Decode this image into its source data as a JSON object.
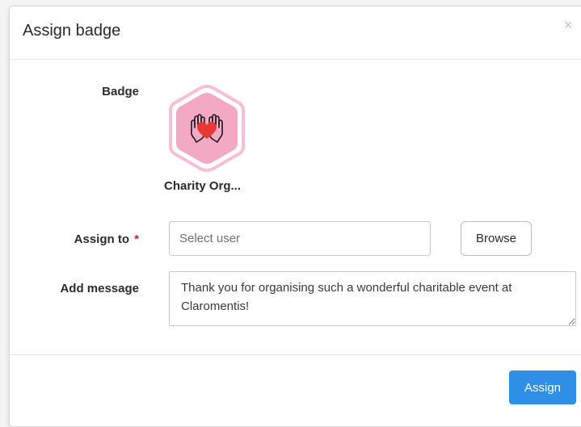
{
  "dialog": {
    "title": "Assign badge",
    "close_label": "×"
  },
  "badge": {
    "label": "Badge",
    "name": "Charity Org...",
    "icon": "hands-heart-icon",
    "colors": {
      "outer": "#f7bfd5",
      "inner": "#f3a8c6",
      "heart": "#e53935"
    }
  },
  "assign_to": {
    "label": "Assign to",
    "required_mark": "*",
    "placeholder": "Select user",
    "browse_label": "Browse"
  },
  "message": {
    "label": "Add message",
    "value": "Thank you for organising such a wonderful charitable event at Claromentis!"
  },
  "footer": {
    "assign_label": "Assign"
  },
  "colors": {
    "primary": "#2f8fe6",
    "required": "#c62828"
  }
}
